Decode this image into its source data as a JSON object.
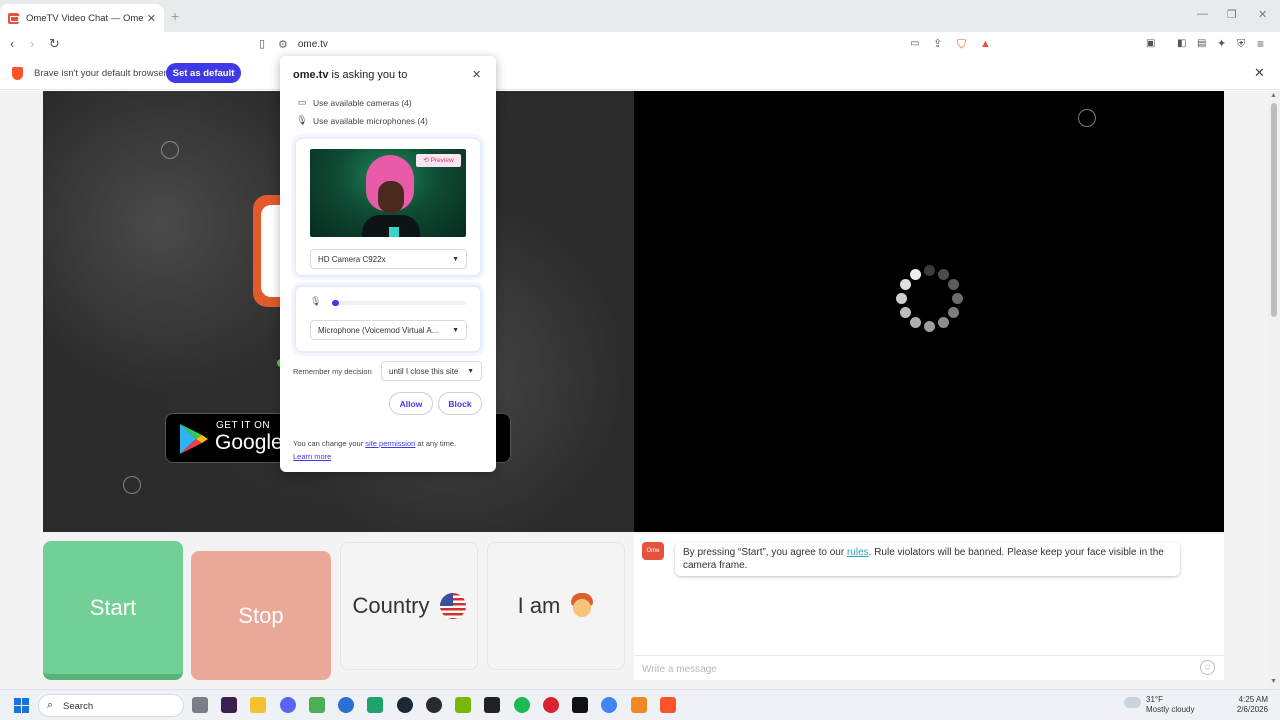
{
  "browser": {
    "tab_title": "OmeTV Video Chat — Omegle R",
    "url": "ome.tv",
    "infobar_message": "Brave isn't your default browser",
    "set_default_label": "Set as default"
  },
  "permission_popup": {
    "site": "ome.tv",
    "asking_text": "is asking you to",
    "cameras_label": "Use available cameras (4)",
    "microphones_label": "Use available microphones (4)",
    "preview_label": "Preview",
    "camera_select": "HD Camera C922x",
    "microphone_select": "Microphone (Voicemod Virtual A...",
    "mic_level_fraction": 0.05,
    "remember_label": "Remember my decision",
    "remember_select": "until I close this site",
    "allow_label": "Allow",
    "block_label": "Block",
    "footer_prefix": "You can change your",
    "footer_link": "site permission",
    "footer_suffix": "at any time.",
    "learn_more": "Learn more"
  },
  "video_left": {
    "store_small": "GET IT ON",
    "store_big": "Google"
  },
  "controls": {
    "start_label": "Start",
    "stop_label": "Stop",
    "country_label": "Country",
    "iam_label": "I am"
  },
  "chat": {
    "logo_text": "Ome TV",
    "message_prefix": "By pressing “Start”, you agree to our",
    "rules_link": "rules",
    "message_suffix": ". Rule violators will be banned. Please keep your face visible in the camera frame.",
    "input_placeholder": "Write a message"
  },
  "taskbar": {
    "search_label": "Search",
    "weather_temp": "31°F",
    "weather_desc": "Mostly cloudy",
    "time": "4:25 AM",
    "date": "2/6/2026"
  },
  "colors": {
    "brave_accent": "#3f39e8",
    "start_green": "#72cf95",
    "stop_salmon": "#e9a898",
    "omegle_orange": "#e5533d"
  }
}
